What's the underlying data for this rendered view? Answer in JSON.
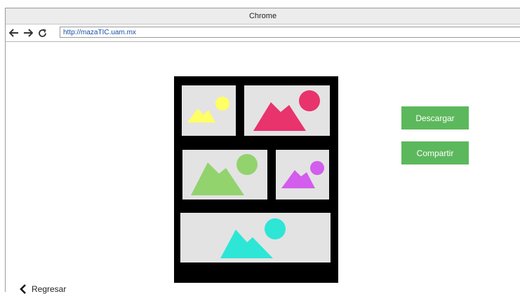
{
  "window": {
    "title": "Chrome"
  },
  "navbar": {
    "back_icon": "arrow-left-icon",
    "forward_icon": "arrow-right-icon",
    "reload_icon": "reload-icon",
    "url": "http://mazaTIC.uam.mx"
  },
  "collage": {
    "panels": [
      {
        "icon": "image-placeholder-icon",
        "color": "#ffff66"
      },
      {
        "icon": "image-placeholder-icon",
        "color": "#e8336d"
      },
      {
        "icon": "image-placeholder-icon",
        "color": "#92d36e"
      },
      {
        "icon": "image-placeholder-icon",
        "color": "#d35ded"
      },
      {
        "icon": "image-placeholder-icon",
        "color": "#2ee6d6"
      }
    ]
  },
  "actions": {
    "download_label": "Descargar",
    "share_label": "Compartir",
    "accent": "#5cb85c"
  },
  "footer": {
    "back_icon": "chevron-left-icon",
    "back_label": "Regresar"
  }
}
